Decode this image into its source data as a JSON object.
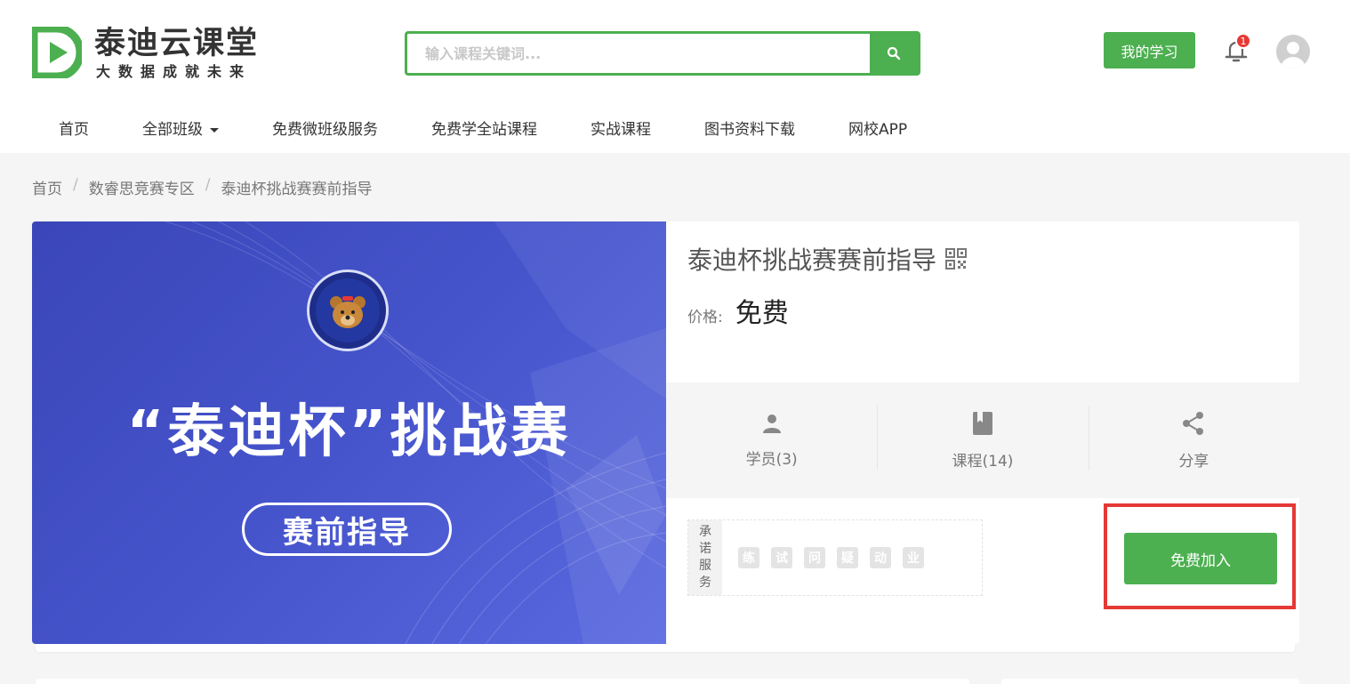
{
  "header": {
    "logo_title": "泰迪云课堂",
    "logo_subtitle": "大数据成就未来",
    "search_placeholder": "输入课程关键词...",
    "my_study_label": "我的学习",
    "notification_count": "1"
  },
  "nav": {
    "items": [
      "首页",
      "全部班级",
      "免费微班级服务",
      "免费学全站课程",
      "实战课程",
      "图书资料下载",
      "网校APP"
    ]
  },
  "breadcrumb": [
    "首页",
    "数睿思竞赛专区",
    "泰迪杯挑战赛赛前指导"
  ],
  "course": {
    "cover_title": "“泰迪杯”挑战赛",
    "cover_badge": "赛前指导",
    "title": "泰迪杯挑战赛赛前指导",
    "price_label": "价格:",
    "price_value": "免费",
    "stats": [
      {
        "icon": "user-icon",
        "label": "学员(3)"
      },
      {
        "icon": "book-icon",
        "label": "课程(14)"
      },
      {
        "icon": "share-icon",
        "label": "分享"
      }
    ],
    "promise_label": "承诺服务",
    "promise_tags": [
      "练",
      "试",
      "问",
      "疑",
      "动",
      "业"
    ],
    "join_label": "免费加入"
  },
  "colors": {
    "brand_green": "#4caf50",
    "highlight_red": "#e53935",
    "cover_blue": "#4654cc"
  }
}
